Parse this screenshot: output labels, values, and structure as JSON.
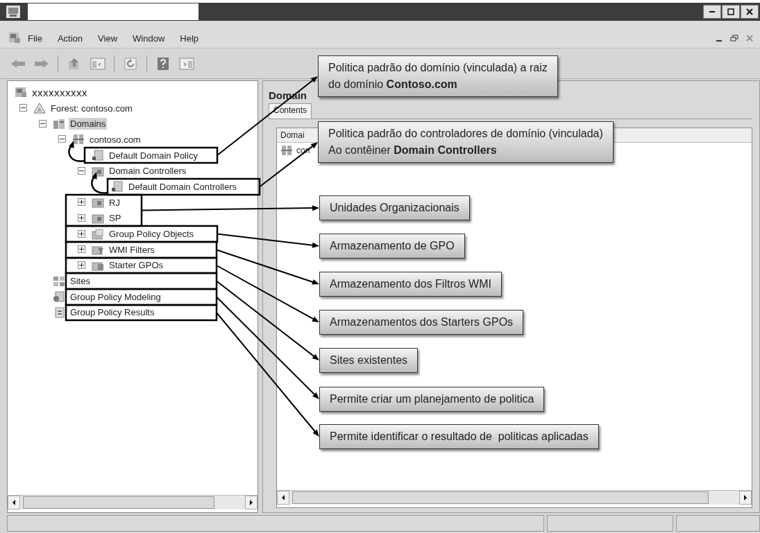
{
  "menu_bar": {
    "items": [
      "File",
      "Action",
      "View",
      "Window",
      "Help"
    ]
  },
  "tree": {
    "items": [
      {
        "label": "xxxxxxxxxx",
        "kind": "root",
        "selected": false,
        "children": [
          {
            "label": "Forest: contoso.com",
            "kind": "forest",
            "selected": false,
            "expanded": true,
            "children": [
              {
                "label": "Domains",
                "kind": "domains",
                "selected": true,
                "expanded": true,
                "children": [
                  {
                    "label": "contoso.com",
                    "kind": "domain",
                    "selected": false,
                    "expanded": true,
                    "children": [
                      {
                        "label": "Default Domain Policy",
                        "kind": "gpo_link",
                        "selected": false
                      },
                      {
                        "label": "Domain Controllers",
                        "kind": "ou",
                        "selected": false,
                        "expanded": true,
                        "children": [
                          {
                            "label": "Default Domain Controllers",
                            "kind": "gpo_link",
                            "selected": false
                          }
                        ]
                      },
                      {
                        "label": "RJ",
                        "kind": "ou",
                        "selected": false,
                        "expanded": false
                      },
                      {
                        "label": "SP",
                        "kind": "ou",
                        "selected": false,
                        "expanded": false
                      },
                      {
                        "label": "Group Policy Objects",
                        "kind": "gpo_container",
                        "selected": false,
                        "expanded": false
                      },
                      {
                        "label": "WMI Filters",
                        "kind": "wmi",
                        "selected": false,
                        "expanded": false
                      },
                      {
                        "label": "Starter GPOs",
                        "kind": "starter",
                        "selected": false,
                        "expanded": false
                      }
                    ]
                  }
                ]
              },
              {
                "label": "Sites",
                "kind": "sites",
                "selected": false
              },
              {
                "label": "Group Policy Modeling",
                "kind": "modeling",
                "selected": false
              },
              {
                "label": "Group Policy Results",
                "kind": "results",
                "selected": false
              }
            ]
          }
        ]
      }
    ]
  },
  "details_pane": {
    "title": "Domain",
    "tabs": [
      {
        "label": "Contents",
        "selected": true
      }
    ],
    "list": {
      "columns": [
        "Domai"
      ],
      "rows": [
        {
          "cells": [
            "con"
          ]
        }
      ]
    }
  },
  "callouts": [
    {
      "text": "Politica padrão do domínio (vinculada) a raiz\ndo domínio **Contoso.com**"
    },
    {
      "text": "Politica padrão do controladores de domínio (vinculada)\nAo contêiner **Domain Controllers**"
    },
    {
      "text": "Unidades Organizacionais"
    },
    {
      "text": "Armazenamento de GPO"
    },
    {
      "text": "Armazenamento dos Filtros WMI"
    },
    {
      "text": "Armazenamentos dos Starters GPOs"
    },
    {
      "text": "Sites existentes"
    },
    {
      "text": "Permite criar um planejamento de politica"
    },
    {
      "text": "Permite identificar o resultado de  politicas aplicadas"
    }
  ]
}
